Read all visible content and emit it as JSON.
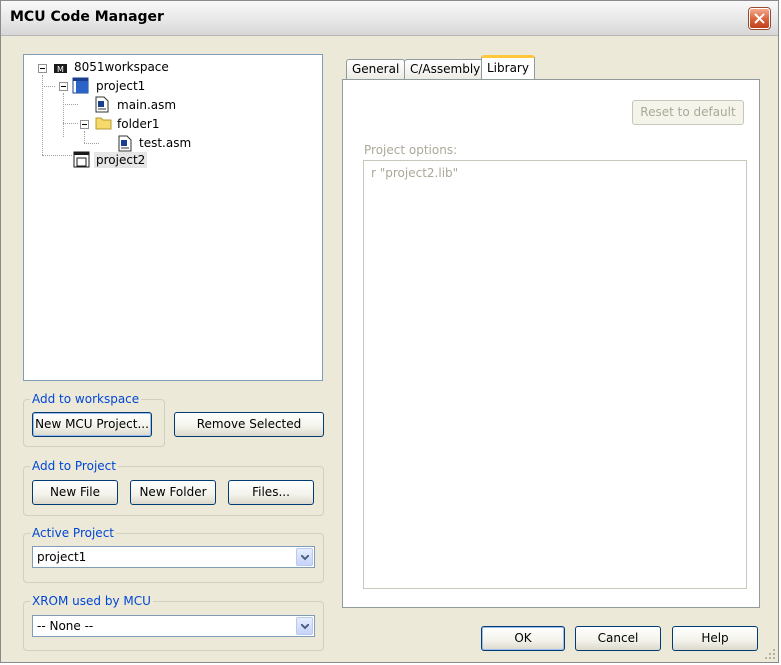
{
  "window": {
    "title": "MCU Code Manager"
  },
  "tree": {
    "workspace": "8051workspace",
    "project1": "project1",
    "main_file": "main.asm",
    "folder": "folder1",
    "folder_file": "test.asm",
    "project2": "project2"
  },
  "add_to_workspace": {
    "legend": "Add to workspace",
    "new_project_label": "New MCU Project...",
    "remove_label": "Remove Selected"
  },
  "add_to_project": {
    "legend": "Add to Project",
    "new_file_label": "New File",
    "new_folder_label": "New Folder",
    "files_label": "Files..."
  },
  "active_project": {
    "legend": "Active Project",
    "value": "project1"
  },
  "xrom": {
    "legend": "XROM used by MCU",
    "value": "-- None --"
  },
  "tabs": [
    {
      "label": "General"
    },
    {
      "label": "C/Assembly"
    },
    {
      "label": "Library"
    }
  ],
  "active_tab": "Library",
  "library": {
    "reset_label": "Reset to default",
    "options_label": "Project options:",
    "options_value": "r \"project2.lib\""
  },
  "footer": {
    "ok_label": "OK",
    "cancel_label": "Cancel",
    "help_label": "Help"
  },
  "colors": {
    "legend_blue": "#0046d5",
    "tab_highlight": "#ffc73c",
    "close_red": "#d8603a",
    "disabled_text": "#aca899"
  }
}
